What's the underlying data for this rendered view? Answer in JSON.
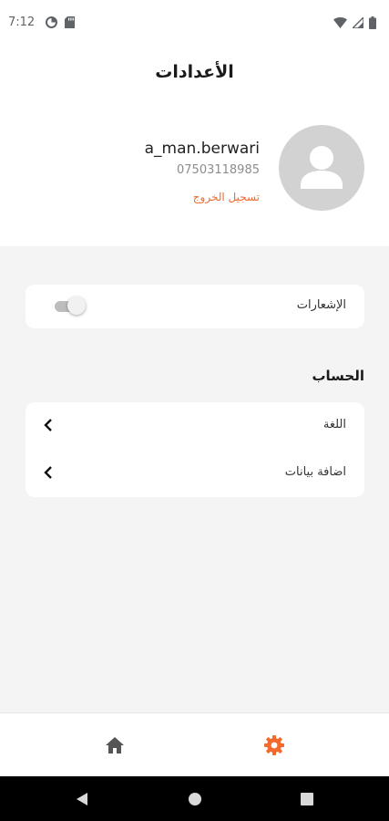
{
  "status_bar": {
    "time": "7:12",
    "left_icons": [
      "data-saver-icon",
      "sd-card-icon"
    ],
    "right_icons": [
      "wifi-icon",
      "cellular-signal-icon",
      "battery-icon"
    ]
  },
  "header": {
    "title": "الأعدادات"
  },
  "profile": {
    "username": "a_man.berwari",
    "phone": "07503118985",
    "logout_label": "تسجيل الخروج",
    "avatar_icon": "person-icon"
  },
  "notifications": {
    "label": "الإشعارات",
    "enabled": false
  },
  "account": {
    "section_title": "الحساب",
    "items": [
      {
        "label": "اللغة",
        "icon": "chevron-left-icon"
      },
      {
        "label": "اضافة بيانات",
        "icon": "chevron-left-icon"
      }
    ]
  },
  "bottom_nav": {
    "items": [
      {
        "icon": "home-icon",
        "active": false
      },
      {
        "icon": "gear-icon",
        "active": true
      }
    ]
  },
  "colors": {
    "accent": "#f26a2e",
    "background": "#f4f4f4",
    "card": "#ffffff",
    "avatar_bg": "#d2d2d2",
    "nav_inactive": "#555555"
  },
  "system_nav": {
    "icons": [
      "back-triangle-icon",
      "home-circle-icon",
      "recents-square-icon"
    ]
  }
}
